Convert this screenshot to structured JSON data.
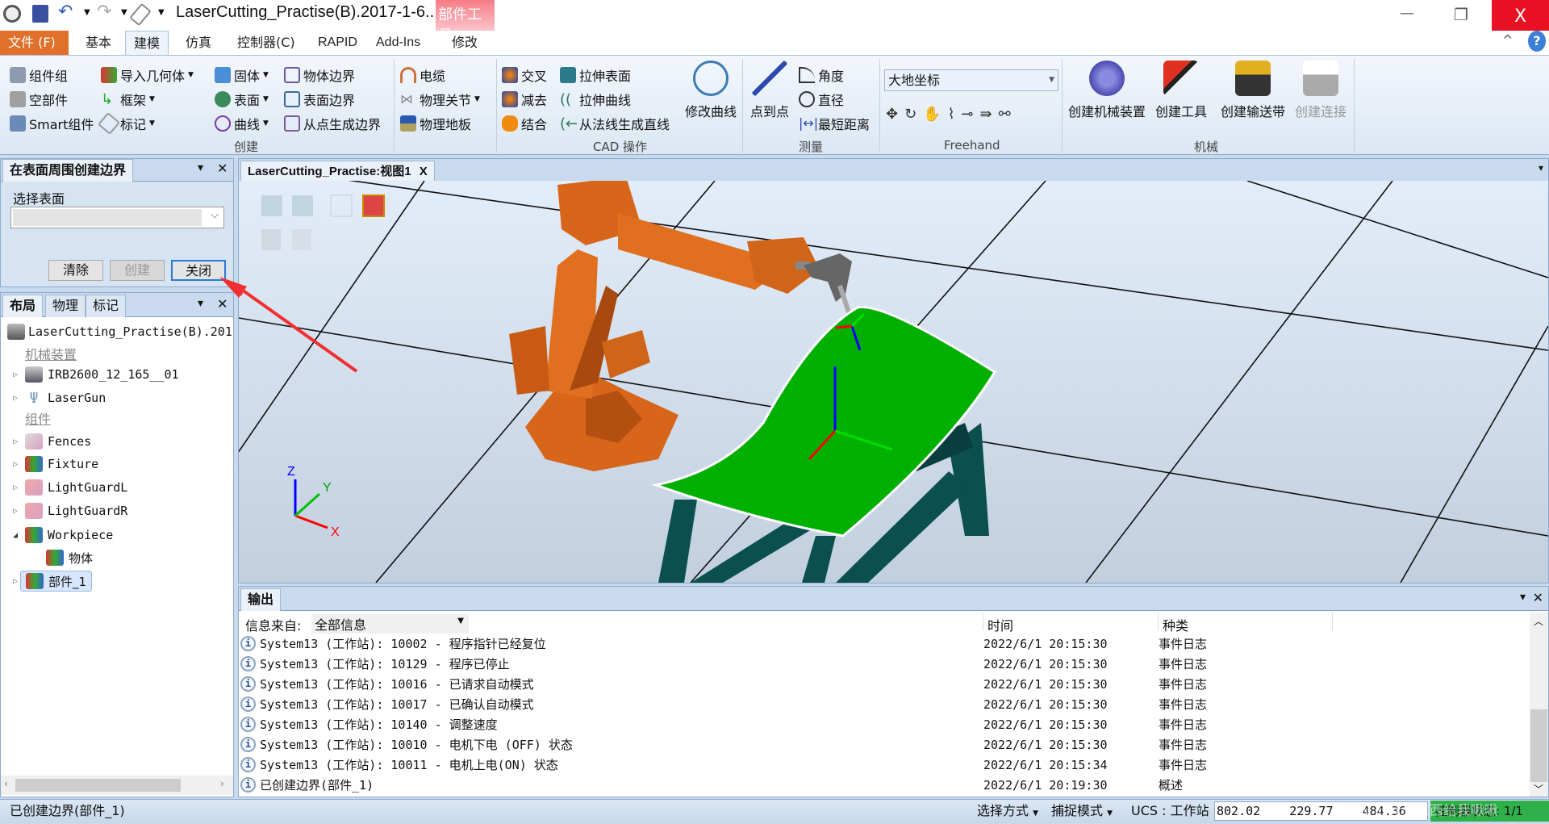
{
  "window": {
    "title": "LaserCutting_Practise(B).2017-1-6...",
    "context_tab": "部件工具",
    "minimize": "—",
    "restore": "❐",
    "close": "X",
    "help": "?",
    "collapse": "^"
  },
  "ribbon_tabs": [
    {
      "label": "文件 (F)"
    },
    {
      "label": "基本"
    },
    {
      "label": "建模"
    },
    {
      "label": "仿真"
    },
    {
      "label": "控制器(C)"
    },
    {
      "label": "RAPID"
    },
    {
      "label": "Add-Ins"
    },
    {
      "label": "修改"
    }
  ],
  "ribbon": {
    "create": {
      "label": "创建",
      "items": [
        "组件组",
        "空部件",
        "Smart组件",
        "导入几何体",
        "框架",
        "标记",
        "固体",
        "表面",
        "曲线",
        "物体边界",
        "表面边界",
        "从点生成边界",
        "电缆",
        "物理关节",
        "物理地板"
      ]
    },
    "cad": {
      "label": "CAD 操作",
      "items": [
        "交叉",
        "减去",
        "结合",
        "拉伸表面",
        "拉伸曲线",
        "从法线生成直线",
        "修改曲线"
      ]
    },
    "measure": {
      "label": "测量",
      "items": [
        "点到点",
        "角度",
        "直径",
        "最短距离"
      ]
    },
    "freehand": {
      "label": "Freehand",
      "frame_select": "大地坐标"
    },
    "mechanism": {
      "label": "机械",
      "items": [
        "创建机械装置",
        "创建工具",
        "创建输送带",
        "创建连接"
      ]
    }
  },
  "boundary_panel": {
    "title": "在表面周围创建边界",
    "select_label": "选择表面",
    "select_value": "",
    "clear": "清除",
    "create": "创建",
    "close": "关闭"
  },
  "layout_panel": {
    "tabs": [
      "布局",
      "物理",
      "标记"
    ],
    "tree": [
      {
        "label": "LaserCutting_Practise(B).201",
        "type": "station"
      },
      {
        "label": "机械装置",
        "type": "category"
      },
      {
        "label": "IRB2600_12_165__01",
        "type": "robot"
      },
      {
        "label": "LaserGun",
        "type": "tool"
      },
      {
        "label": "组件",
        "type": "category"
      },
      {
        "label": "Fences",
        "type": "part"
      },
      {
        "label": "Fixture",
        "type": "part"
      },
      {
        "label": "LightGuardL",
        "type": "part"
      },
      {
        "label": "LightGuardR",
        "type": "part"
      },
      {
        "label": "Workpiece",
        "type": "part",
        "expanded": true
      },
      {
        "label": "物体",
        "type": "body"
      },
      {
        "label": "部件_1",
        "type": "part",
        "selected": true
      }
    ]
  },
  "viewport": {
    "tab": "LaserCutting_Practise:视图1",
    "tab_close": "X",
    "axes": {
      "x": "X",
      "y": "Y",
      "z": "Z"
    }
  },
  "output": {
    "title": "输出",
    "filter_label": "信息来自:",
    "filter_value": "全部信息",
    "columns": [
      "时间",
      "种类"
    ],
    "rows": [
      {
        "msg": "System13 (工作站): 10002 - 程序指针已经复位",
        "time": "2022/6/1 20:15:30",
        "kind": "事件日志"
      },
      {
        "msg": "System13 (工作站): 10129 - 程序已停止",
        "time": "2022/6/1 20:15:30",
        "kind": "事件日志"
      },
      {
        "msg": "System13 (工作站): 10016 - 已请求自动模式",
        "time": "2022/6/1 20:15:30",
        "kind": "事件日志"
      },
      {
        "msg": "System13 (工作站): 10017 - 已确认自动模式",
        "time": "2022/6/1 20:15:30",
        "kind": "事件日志"
      },
      {
        "msg": "System13 (工作站): 10140 - 调整速度",
        "time": "2022/6/1 20:15:30",
        "kind": "事件日志"
      },
      {
        "msg": "System13 (工作站): 10010 - 电机下电 (OFF) 状态",
        "time": "2022/6/1 20:15:30",
        "kind": "事件日志"
      },
      {
        "msg": "System13 (工作站): 10011 - 电机上电(ON) 状态",
        "time": "2022/6/1 20:15:34",
        "kind": "事件日志"
      },
      {
        "msg": "已创建边界(部件_1)",
        "time": "2022/6/1 20:19:30",
        "kind": "概述"
      }
    ]
  },
  "status": {
    "message": "已创建边界(部件_1)",
    "select_mode": "选择方式",
    "snap_mode": "捕捉模式",
    "ucs": "UCS : 工作站",
    "coords": "802.02    229.77    484.36",
    "controller": "控制器状态: 1/1",
    "watermark": "CSDN @什么东西给我啾啾"
  },
  "colors": {
    "file_tab": "#e0702a",
    "robot": "#e07020",
    "surface": "#00b000",
    "table": "#0b4f4f",
    "arrow": "#f03030"
  }
}
